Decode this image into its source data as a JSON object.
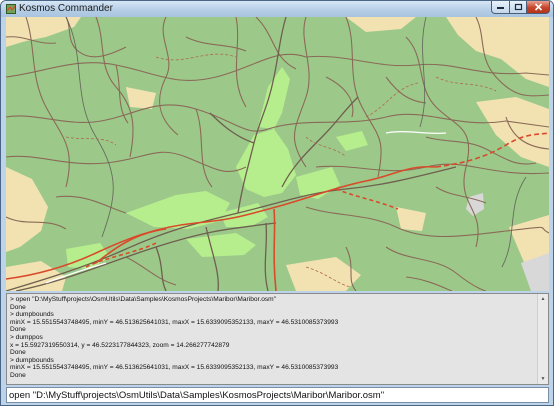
{
  "window": {
    "title": "Kosmos Commander",
    "icon": "kosmos-app-icon",
    "controls": [
      "minimize-icon",
      "maximize-icon",
      "close-icon"
    ]
  },
  "map": {
    "colors": {
      "background": "#9cc98a",
      "forest_light": "#b7ee8d",
      "farmland": "#f2e2b2",
      "residential": "#d8d8d8",
      "roads": "#8a6a57",
      "major_road": "#d94a2b",
      "track": "#ad6a52",
      "stream": "#5d5d54"
    }
  },
  "console": {
    "lines": [
      "> open \"D:\\MyStuff\\projects\\OsmUtils\\Data\\Samples\\KosmosProjects\\Maribor\\Maribor.osm\"",
      "Done",
      "> dumpbounds",
      "minX = 15.5515543748495, minY = 46.513625641031, maxX = 15.6339095352133, maxY = 46.5310085373993",
      "Done",
      "> dumppos",
      "x = 15.5927319550314, y = 46.5223177844323, zoom = 14.266277742879",
      "Done",
      "> dumpbounds",
      "minX = 15.5515543748495, minY = 46.513625641031, maxX = 15.6339095352133, maxY = 46.5310085373993",
      "Done"
    ]
  },
  "input": {
    "value": "open \"D:\\MyStuff\\projects\\OsmUtils\\Data\\Samples\\KosmosProjects\\Maribor\\Maribor.osm\""
  }
}
